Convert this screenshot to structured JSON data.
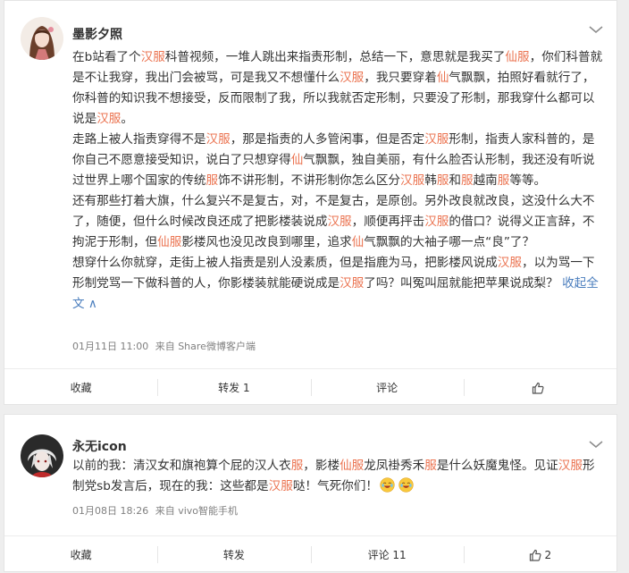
{
  "post1": {
    "username": "墨影夕照",
    "paragraphs": [
      [
        {
          "t": "在b站看了个"
        },
        {
          "t": "汉服",
          "hl": true
        },
        {
          "t": "科普视频，一堆人跳出来指责形制，总结一下，意思就是我买了"
        },
        {
          "t": "仙服",
          "hl": true
        },
        {
          "t": "，你们科普就是不让我穿，我出门会被骂，可是我又不想懂什么"
        },
        {
          "t": "汉服",
          "hl": true
        },
        {
          "t": "，我只要穿着"
        },
        {
          "t": "仙",
          "hl": true
        },
        {
          "t": "气飘飘，拍照好看就行了，你科普的知识我不想接受，反而限制了我，所以我就否定形制，只要没了形制，那我穿什么都可以说是"
        },
        {
          "t": "汉服",
          "hl": true
        },
        {
          "t": "。"
        }
      ],
      [
        {
          "t": "走路上被人指责穿得不是"
        },
        {
          "t": "汉服",
          "hl": true
        },
        {
          "t": "，那是指责的人多管闲事，但是否定"
        },
        {
          "t": "汉服",
          "hl": true
        },
        {
          "t": "形制，指责人家科普的，是你自己不愿意接受知识，说白了只想穿得"
        },
        {
          "t": "仙",
          "hl": true
        },
        {
          "t": "气飘飘，独自美丽，有什么脸否认形制，我还没有听说过世界上哪个国家的传统"
        },
        {
          "t": "服",
          "hl": true
        },
        {
          "t": "饰不讲形制，不讲形制你怎么区分"
        },
        {
          "t": "汉服",
          "hl": true
        },
        {
          "t": "韩"
        },
        {
          "t": "服",
          "hl": true
        },
        {
          "t": "和"
        },
        {
          "t": "服",
          "hl": true
        },
        {
          "t": "越南"
        },
        {
          "t": "服",
          "hl": true
        },
        {
          "t": "等等。"
        }
      ],
      [
        {
          "t": "还有那些打着大旗，什么复兴不是复古，对，不是复古，是原创。另外改良就改良，这没什么大不了，随便，但什么时候改良还成了把影楼装说成"
        },
        {
          "t": "汉服",
          "hl": true
        },
        {
          "t": "，顺便再抨击"
        },
        {
          "t": "汉服",
          "hl": true
        },
        {
          "t": "的借口？说得义正言辞，不拘泥于形制，但"
        },
        {
          "t": "仙服",
          "hl": true
        },
        {
          "t": "影楼风也没见改良到哪里，追求"
        },
        {
          "t": "仙",
          "hl": true
        },
        {
          "t": "气飘飘的大袖子哪一点“良”了？"
        }
      ],
      [
        {
          "t": "想穿什么你就穿，走街上被人指责是别人没素质，但是指鹿为马，把影楼风说成"
        },
        {
          "t": "汉服",
          "hl": true
        },
        {
          "t": "，以为骂一下形制党骂一下做科普的人，你影楼装就能硬说成是"
        },
        {
          "t": "汉服",
          "hl": true
        },
        {
          "t": "了吗？叫冤叫屈就能把苹果说成梨？ "
        },
        {
          "t": "收起全文 ∧",
          "fold": true
        }
      ]
    ],
    "date": "01月11日 11:00",
    "source": "来自 Share微博客户端",
    "actions": {
      "favorite": "收藏",
      "repost": "转发 1",
      "comment": "评论",
      "like_count": ""
    }
  },
  "post2": {
    "username": "永无icon",
    "segments": [
      {
        "t": "以前的我：清汉女和旗袍算个屁的汉人衣"
      },
      {
        "t": "服",
        "hl": true
      },
      {
        "t": "，影楼"
      },
      {
        "t": "仙服",
        "hl": true
      },
      {
        "t": "龙凤褂秀禾"
      },
      {
        "t": "服",
        "hl": true
      },
      {
        "t": "是什么妖魔鬼怪。见证"
      },
      {
        "t": "汉服",
        "hl": true
      },
      {
        "t": "形制党sb发言后，现在的我：这些都是"
      },
      {
        "t": "汉服",
        "hl": true
      },
      {
        "t": "哒！气死你们！"
      },
      {
        "emoji": "laugh-cry"
      },
      {
        "emoji": "laugh-cry"
      }
    ],
    "date": "01月08日 18:26",
    "source": "来自 vivo智能手机",
    "actions": {
      "favorite": "收藏",
      "repost": "转发",
      "comment": "评论 11",
      "like_count": "2"
    }
  },
  "colors": {
    "highlight": "#eb7350",
    "link": "#4a7dbd",
    "meta": "#808080"
  }
}
